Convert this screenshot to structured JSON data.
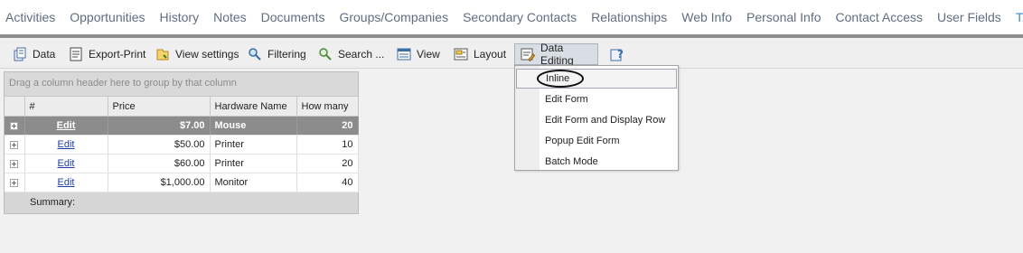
{
  "topnav": {
    "tabs": [
      "Activities",
      "Opportunities",
      "History",
      "Notes",
      "Documents",
      "Groups/Companies",
      "Secondary Contacts",
      "Relationships",
      "Web Info",
      "Personal Info",
      "Contact Access",
      "User Fields",
      "TABLE|IT"
    ]
  },
  "toolbar": {
    "data": "Data",
    "export_print": "Export-Print",
    "view_settings": "View settings",
    "filtering": "Filtering",
    "search": "Search ...",
    "view": "View",
    "layout": "Layout",
    "data_editing": "Data Editing"
  },
  "grid": {
    "group_panel": "Drag a column header here to group by that column",
    "headers": [
      "#",
      "Price",
      "Hardware Name",
      "How many"
    ],
    "rows": [
      {
        "edit": "Edit",
        "price": "$7.00",
        "name": "Mouse",
        "qty": "20"
      },
      {
        "edit": "Edit",
        "price": "$50.00",
        "name": "Printer",
        "qty": "10"
      },
      {
        "edit": "Edit",
        "price": "$60.00",
        "name": "Printer",
        "qty": "20"
      },
      {
        "edit": "Edit",
        "price": "$1,000.00",
        "name": "Monitor",
        "qty": "40"
      }
    ],
    "summary": "Summary:"
  },
  "menu": {
    "items": [
      "Inline",
      "Edit Form",
      "Edit Form and Display Row",
      "Popup Edit Form",
      "Batch Mode"
    ]
  },
  "colors": {
    "accent": "#3e88c6",
    "tab_text": "#5f6e80",
    "selected_row": "#8c8c8c",
    "link": "#1e3fa8"
  }
}
